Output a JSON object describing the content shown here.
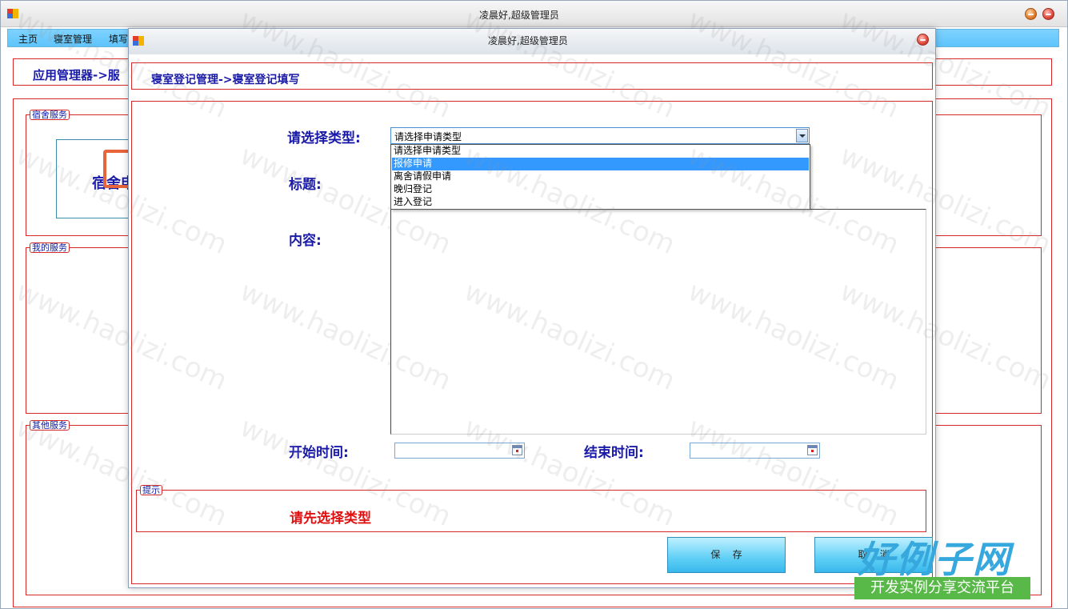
{
  "main_window": {
    "title": "凌晨好,超级管理员",
    "menu": [
      "主页",
      "寝室管理",
      "填写"
    ],
    "breadcrumb": "应用管理器->服",
    "groups": {
      "dorm_service": "宿舍服务",
      "my_service": "我的服务",
      "other_service": "其他服务"
    },
    "dorm_card_label": "宿舍申"
  },
  "dialog": {
    "title": "凌晨好,超级管理员",
    "breadcrumb": "寝室登记管理->寝室登记填写",
    "labels": {
      "type": "请选择类型:",
      "title": "标题:",
      "content": "内容:",
      "start_time": "开始时间:",
      "end_time": "结束时间:"
    },
    "type_select": {
      "value": "请选择申请类型",
      "options": [
        "请选择申请类型",
        "报修申请",
        "离舍请假申请",
        "晚归登记",
        "进入登记"
      ],
      "highlighted_index": 1
    },
    "hint": {
      "group_label": "提示",
      "text": "请先选择类型"
    },
    "buttons": {
      "save": "保    存",
      "cancel": "取    消"
    }
  },
  "watermark": {
    "text": "www.haolizi.com",
    "brand_title": "好例子网",
    "brand_sub": "开发实例分享交流平台"
  },
  "colors": {
    "menu_bar": "#5ec4fb",
    "label_blue": "#1a1aa8",
    "panel_border": "#d62828",
    "hint_red": "#e01010",
    "selection": "#3399ff"
  }
}
